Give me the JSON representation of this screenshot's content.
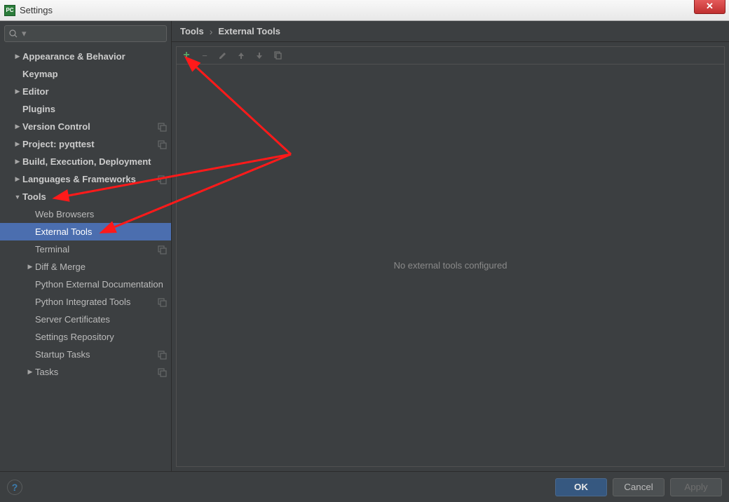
{
  "window": {
    "title": "Settings"
  },
  "search": {
    "placeholder": ""
  },
  "sidebar": {
    "items": [
      {
        "label": "Appearance & Behavior",
        "arrow": "right",
        "bold": true,
        "indent": 0,
        "badge": false
      },
      {
        "label": "Keymap",
        "arrow": "none",
        "bold": true,
        "indent": 0,
        "badge": false
      },
      {
        "label": "Editor",
        "arrow": "right",
        "bold": true,
        "indent": 0,
        "badge": false
      },
      {
        "label": "Plugins",
        "arrow": "none",
        "bold": true,
        "indent": 0,
        "badge": false
      },
      {
        "label": "Version Control",
        "arrow": "right",
        "bold": true,
        "indent": 0,
        "badge": true
      },
      {
        "label": "Project: pyqttest",
        "arrow": "right",
        "bold": true,
        "indent": 0,
        "badge": true
      },
      {
        "label": "Build, Execution, Deployment",
        "arrow": "right",
        "bold": true,
        "indent": 0,
        "badge": false
      },
      {
        "label": "Languages & Frameworks",
        "arrow": "right",
        "bold": true,
        "indent": 0,
        "badge": true
      },
      {
        "label": "Tools",
        "arrow": "down",
        "bold": true,
        "indent": 0,
        "badge": false
      },
      {
        "label": "Web Browsers",
        "arrow": "none",
        "bold": false,
        "indent": 1,
        "badge": false
      },
      {
        "label": "External Tools",
        "arrow": "none",
        "bold": false,
        "indent": 1,
        "badge": false,
        "selected": true
      },
      {
        "label": "Terminal",
        "arrow": "none",
        "bold": false,
        "indent": 1,
        "badge": true
      },
      {
        "label": "Diff & Merge",
        "arrow": "right",
        "bold": false,
        "indent": 1,
        "badge": false
      },
      {
        "label": "Python External Documentation",
        "arrow": "none",
        "bold": false,
        "indent": 1,
        "badge": false
      },
      {
        "label": "Python Integrated Tools",
        "arrow": "none",
        "bold": false,
        "indent": 1,
        "badge": true
      },
      {
        "label": "Server Certificates",
        "arrow": "none",
        "bold": false,
        "indent": 1,
        "badge": false
      },
      {
        "label": "Settings Repository",
        "arrow": "none",
        "bold": false,
        "indent": 1,
        "badge": false
      },
      {
        "label": "Startup Tasks",
        "arrow": "none",
        "bold": false,
        "indent": 1,
        "badge": true
      },
      {
        "label": "Tasks",
        "arrow": "right",
        "bold": false,
        "indent": 1,
        "badge": true
      }
    ]
  },
  "breadcrumb": {
    "root": "Tools",
    "leaf": "External Tools"
  },
  "main": {
    "empty_text": "No external tools configured"
  },
  "footer": {
    "ok": "OK",
    "cancel": "Cancel",
    "apply": "Apply"
  }
}
